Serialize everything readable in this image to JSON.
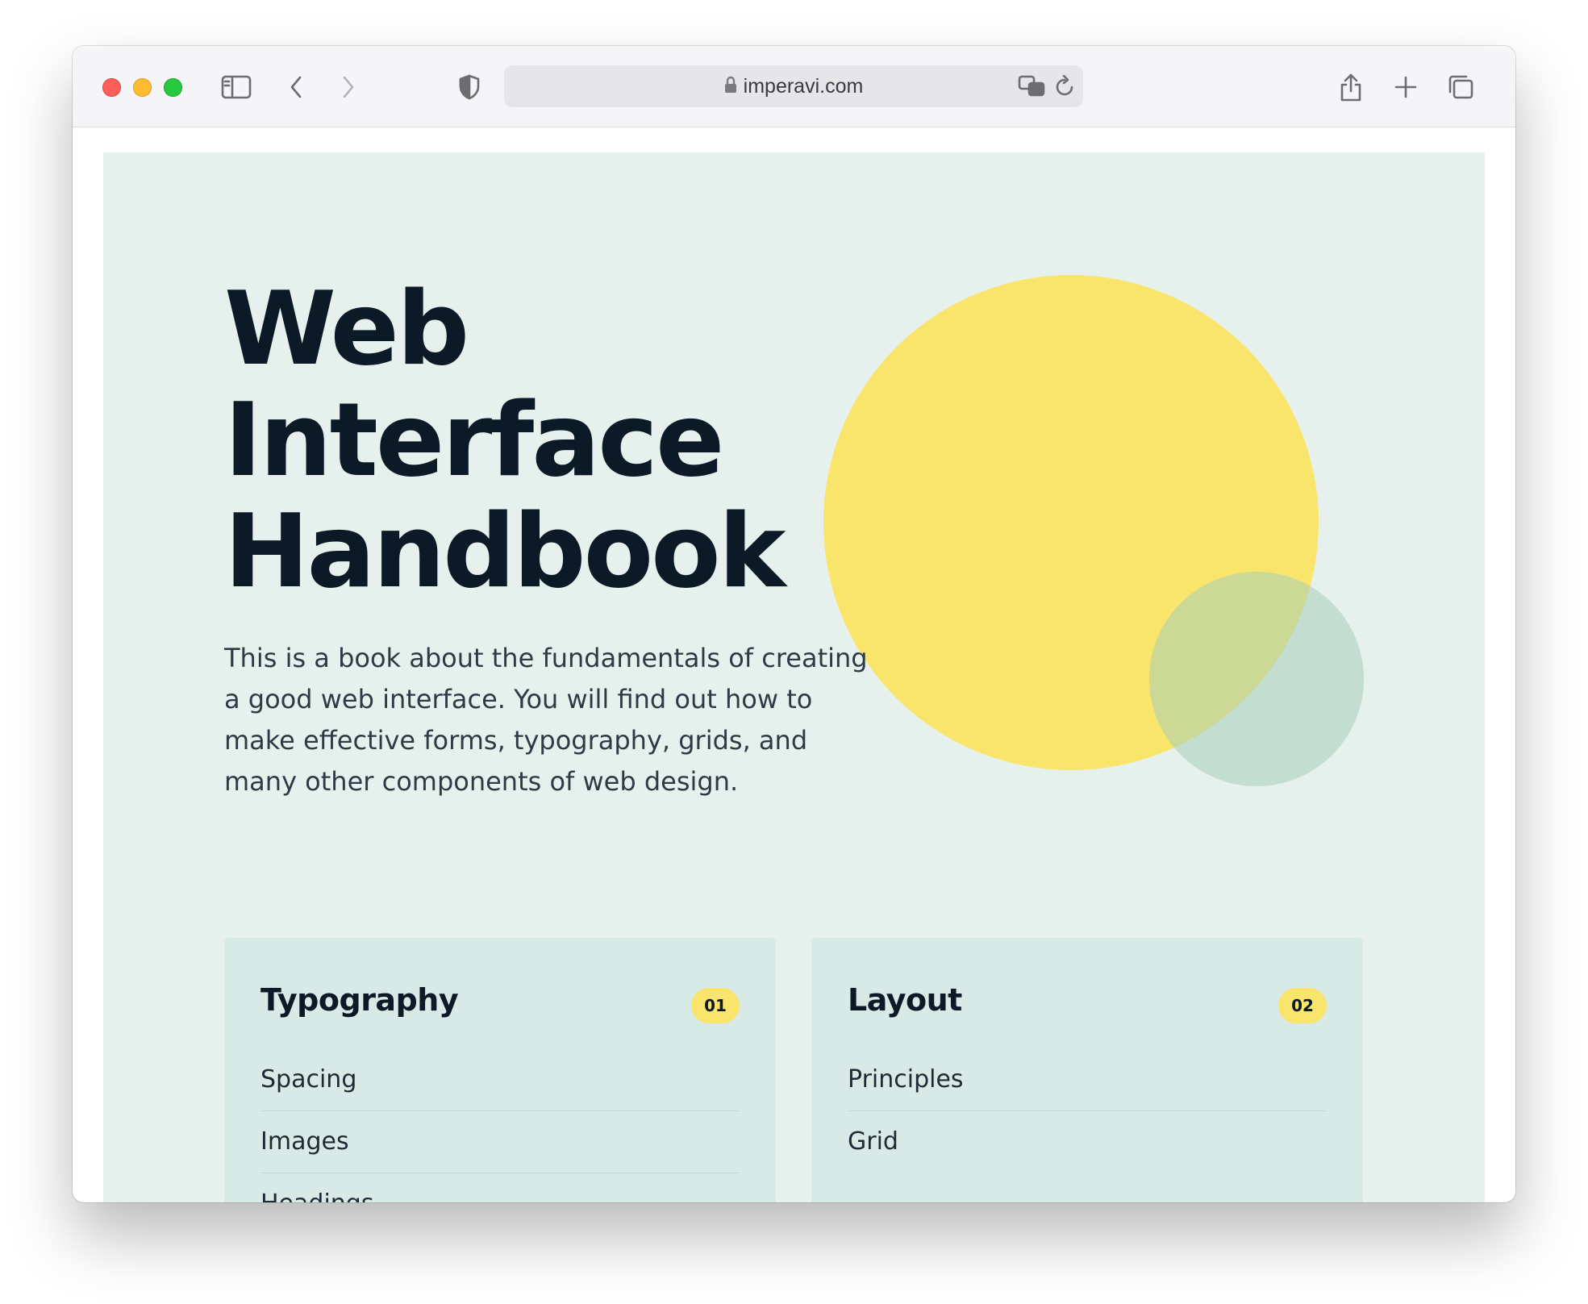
{
  "browser": {
    "url": "imperavi.com",
    "icons": [
      "sidebar-icon",
      "back-icon",
      "forward-icon",
      "shield-icon",
      "lock-icon",
      "translate-icon",
      "reload-icon",
      "share-icon",
      "new-tab-icon",
      "tabs-overview-icon"
    ]
  },
  "hero": {
    "title_lines": [
      "Web",
      "Interface",
      "Handbook"
    ],
    "description": "This is a book about the fundamentals of creating a good web interface. You will find out how to make effective forms, typography, grids, and many other components of web design."
  },
  "colors": {
    "hero_bg": "#e6f1ee",
    "card_bg": "#d7eae5",
    "accent_yellow": "#f9e56b",
    "accent_green": "#a5ceb9",
    "text_dark": "#0b1a26"
  },
  "cards": [
    {
      "title": "Typography",
      "number": "01",
      "items": [
        "Spacing",
        "Images",
        "Headings"
      ]
    },
    {
      "title": "Layout",
      "number": "02",
      "items": [
        "Principles",
        "Grid"
      ]
    }
  ]
}
